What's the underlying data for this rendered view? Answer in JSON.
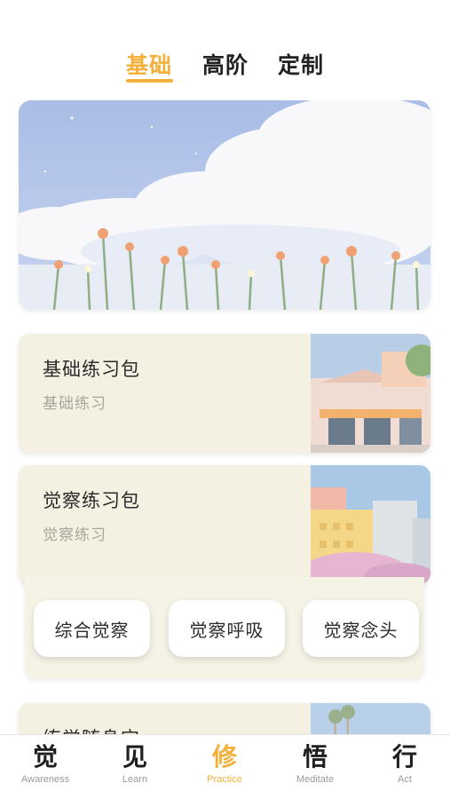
{
  "top_tabs": [
    {
      "label": "基础",
      "active": true
    },
    {
      "label": "高阶",
      "active": false
    },
    {
      "label": "定制",
      "active": false
    }
  ],
  "colors": {
    "accent": "#f3b13c",
    "card_bg": "#f5f1e2",
    "text": "#2a2a2a",
    "muted": "#a9a59a"
  },
  "hero": {
    "image": "night-sky-clouds-flowers-illustration"
  },
  "cards": [
    {
      "title": "基础练习包",
      "subtitle": "基础练习",
      "thumb": "pastel-storefront-illustration"
    },
    {
      "title": "觉察练习包",
      "subtitle": "觉察练习",
      "thumb": "pastel-buildings-blossom-illustration"
    },
    {
      "title": "练觉随身宝",
      "subtitle": "",
      "thumb": "palm-trees-sky-illustration"
    }
  ],
  "sub_items": [
    "综合觉察",
    "觉察呼吸",
    "觉察念头"
  ],
  "bottom_nav": [
    {
      "glyph": "觉",
      "label": "Awareness",
      "active": false
    },
    {
      "glyph": "见",
      "label": "Learn",
      "active": false
    },
    {
      "glyph": "修",
      "label": "Practice",
      "active": true
    },
    {
      "glyph": "悟",
      "label": "Meditate",
      "active": false
    },
    {
      "glyph": "行",
      "label": "Act",
      "active": false
    }
  ]
}
